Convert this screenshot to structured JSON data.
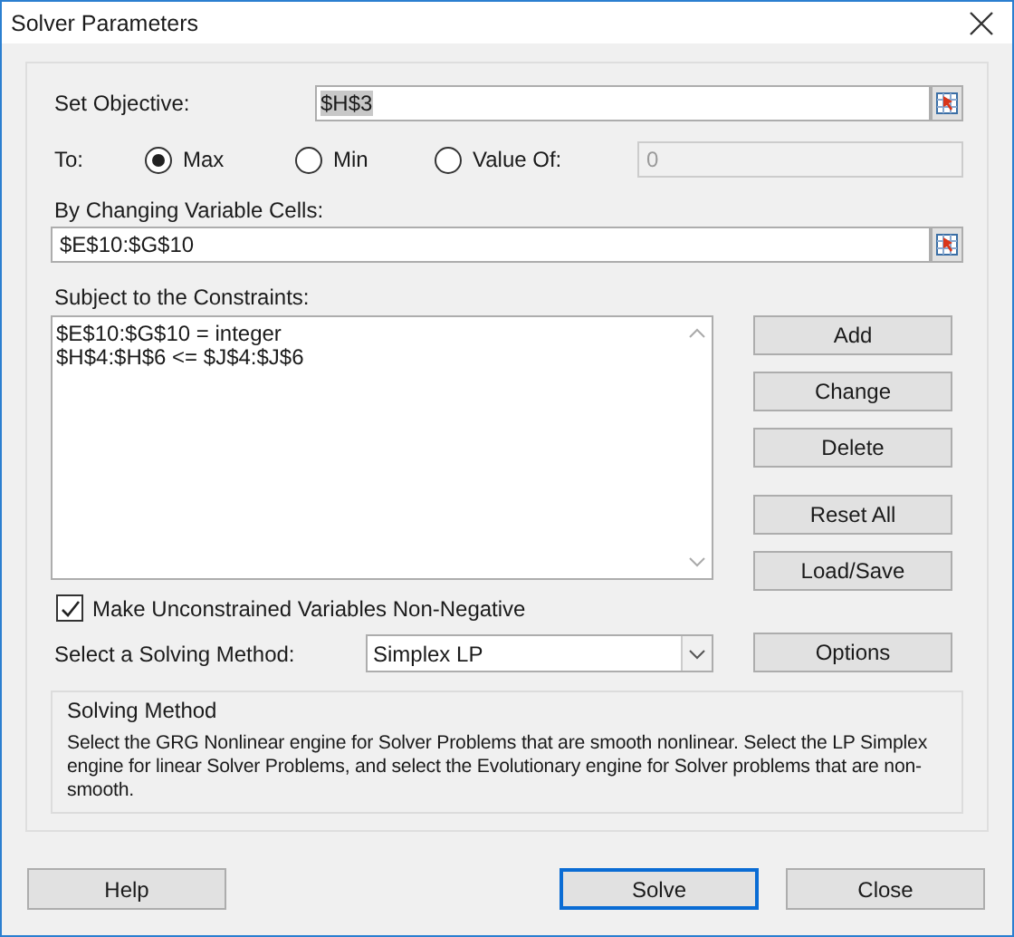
{
  "window": {
    "title": "Solver Parameters"
  },
  "objective": {
    "label": "Set Objective:",
    "value": "$H$3",
    "text_selected": true
  },
  "to": {
    "label": "To:",
    "options": [
      {
        "label": "Max",
        "selected": true
      },
      {
        "label": "Min",
        "selected": false
      },
      {
        "label": "Value Of:",
        "selected": false
      }
    ],
    "value_field": {
      "value": "0",
      "disabled": true
    }
  },
  "changing_cells": {
    "label": "By Changing Variable Cells:",
    "value": "$E$10:$G$10"
  },
  "constraints": {
    "label": "Subject to the Constraints:",
    "items": [
      "$E$10:$G$10 = integer",
      "$H$4:$H$6 <= $J$4:$J$6"
    ]
  },
  "edit_buttons": [
    "Add",
    "Change",
    "Delete"
  ],
  "file_buttons": [
    "Reset All",
    "Load/Save"
  ],
  "nonnegative": {
    "label": "Make Unconstrained Variables Non-Negative",
    "checked": true
  },
  "method": {
    "label": "Select a Solving Method:",
    "value": "Simplex LP",
    "options_button": "Options"
  },
  "method_info": {
    "title": "Solving Method",
    "text": "Select the GRG Nonlinear engine for Solver Problems that are smooth nonlinear. Select the LP Simplex engine for linear Solver Problems, and select the Evolutionary engine for Solver problems that are non-smooth."
  },
  "buttons": [
    {
      "label": "Help",
      "default": false
    },
    {
      "label": "Solve",
      "default": true
    },
    {
      "label": "Close",
      "default": false
    }
  ]
}
